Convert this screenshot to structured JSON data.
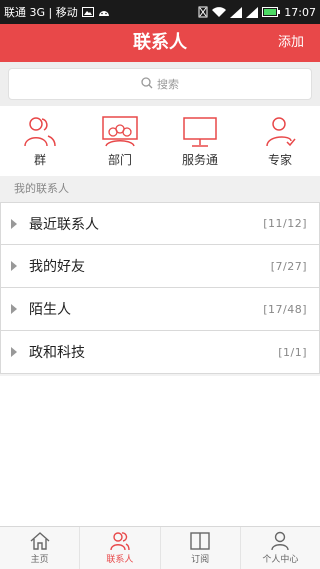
{
  "status_bar": {
    "carrier": "联通 3G | 移动",
    "time": "17:07"
  },
  "header": {
    "title": "联系人",
    "action": "添加"
  },
  "search": {
    "placeholder": "搜索"
  },
  "quick_actions": [
    {
      "label": "群",
      "icon": "group-icon"
    },
    {
      "label": "部门",
      "icon": "department-icon"
    },
    {
      "label": "服务通",
      "icon": "monitor-icon"
    },
    {
      "label": "专家",
      "icon": "expert-icon"
    }
  ],
  "section": {
    "title": "我的联系人"
  },
  "groups": [
    {
      "name": "最近联系人",
      "count": "[11/12]"
    },
    {
      "name": "我的好友",
      "count": "[7/27]"
    },
    {
      "name": "陌生人",
      "count": "[17/48]"
    },
    {
      "name": "政和科技",
      "count": "[1/1]"
    }
  ],
  "tabs": [
    {
      "label": "主页",
      "icon": "home-icon",
      "active": false
    },
    {
      "label": "联系人",
      "icon": "contacts-icon",
      "active": true
    },
    {
      "label": "订阅",
      "icon": "book-icon",
      "active": false
    },
    {
      "label": "个人中心",
      "icon": "user-icon",
      "active": false
    }
  ],
  "colors": {
    "accent": "#e84849",
    "status_bar": "#1a1a1a",
    "battery": "#4cd964"
  }
}
